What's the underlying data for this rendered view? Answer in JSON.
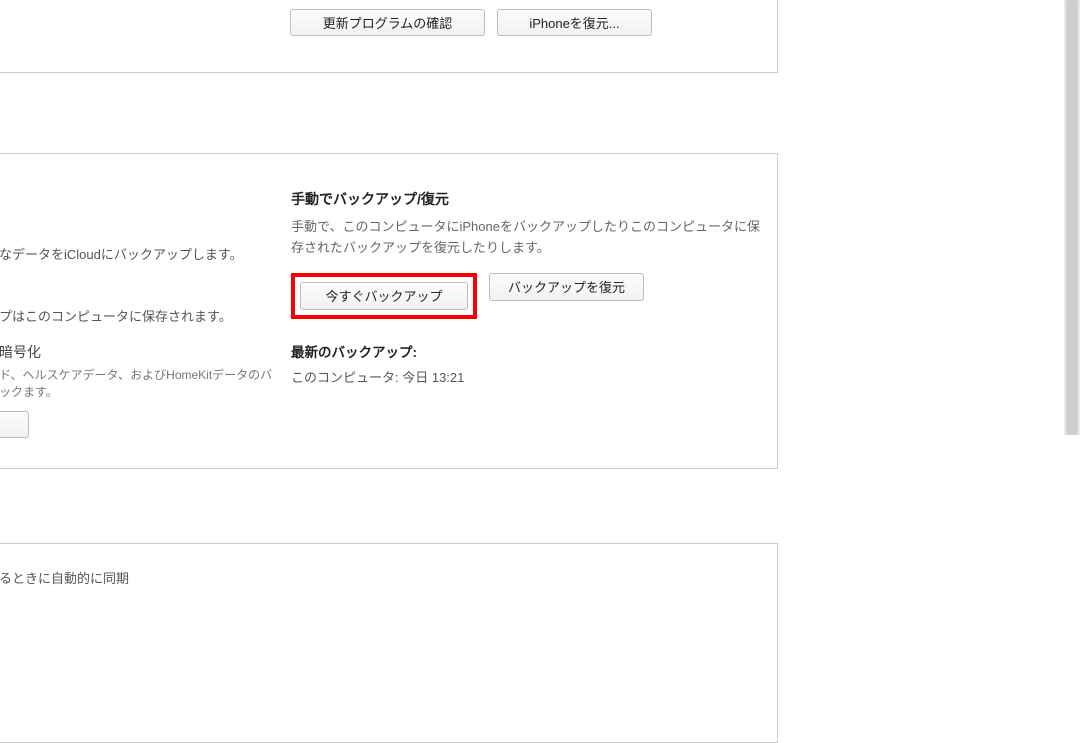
{
  "top": {
    "update_btn": "更新プログラムの確認",
    "restore_btn": "iPhoneを復元..."
  },
  "backup": {
    "heading": "手動でバックアップ/復元",
    "desc": "手動で、このコンピュータにiPhoneをバックアップしたりこのコンピュータに保存されたバックアップを復元したりします。",
    "backup_now_btn": "今すぐバックアップ",
    "restore_btn": "バックアップを復元",
    "last_heading": "最新のバックアップ:",
    "last_text": "このコンピュータ: 今日 13:21"
  },
  "left": {
    "icloud": "なデータをiCloudにバックアップします。",
    "computer": "プはこのコンピュータに保存されます。",
    "encrypt_heading": "暗号化",
    "encrypt_desc": "ド、ヘルスケアデータ、およびHomeKitデータのバックます。"
  },
  "bottom": {
    "sync": "るときに自動的に同期"
  }
}
